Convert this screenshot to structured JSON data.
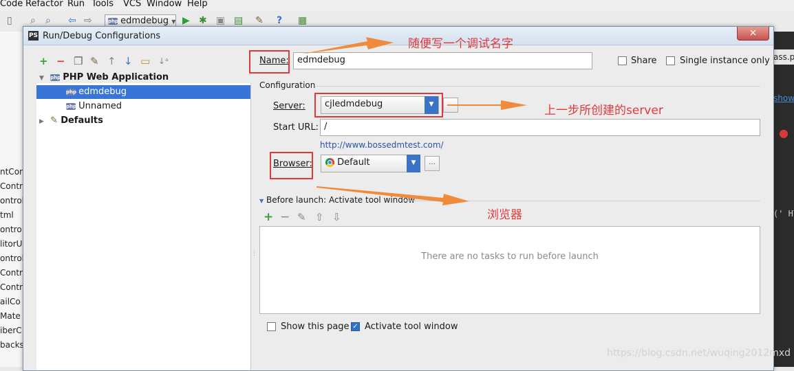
{
  "menubar": {
    "items": [
      "Code",
      "Refactor",
      "Run",
      "Tools",
      "VCS",
      "Window",
      "Help"
    ]
  },
  "toolbar": {
    "run_config_combo": "edmdebug",
    "icons": [
      "open-icon",
      "find-icon",
      "replace-icon",
      "back-icon",
      "forward-icon",
      "run-icon",
      "debug-icon",
      "coverage-icon",
      "vcs-icon",
      "settings-icon",
      "help-icon",
      "plugin-icon"
    ]
  },
  "background": {
    "left_lines": [
      "ntConf",
      "Contro",
      "ontrol",
      "tml",
      "ontro",
      "litorU",
      "ontrol",
      "Contro",
      "Contr",
      "ailCo",
      "Mate",
      "iberC",
      "backs"
    ],
    "right_lines": [
      "ass.ph",
      "show",
      "(' HT"
    ]
  },
  "dialog": {
    "title": "Run/Debug Configurations",
    "close_label": "×",
    "left_toolbar": [
      "add-icon",
      "remove-icon",
      "copy-icon",
      "edit-defaults-icon",
      "move-up-icon",
      "move-down-icon",
      "folder-icon",
      "sort-icon"
    ],
    "tree": {
      "group": "PHP Web Application",
      "items": [
        "edmdebug",
        "Unnamed"
      ],
      "selected": "edmdebug",
      "defaults": "Defaults"
    },
    "name_label": "Name:",
    "name_value": "edmdebug",
    "share_label": "Share",
    "single_instance_label": "Single instance only",
    "share_checked": false,
    "single_instance_checked": false,
    "configuration_label": "Configuration",
    "server_label": "Server:",
    "server_value": "cjledmdebug",
    "start_url_label": "Start URL:",
    "start_url_value": "/",
    "url_preview": "http://www.bossedmtest.com/",
    "browser_label": "Browser:",
    "browser_value": "Default",
    "dots_label": "...",
    "before_launch_label": "Before launch: Activate tool window",
    "before_launch_tools": [
      "add-task-icon",
      "remove-task-icon",
      "edit-task-icon",
      "task-up-icon",
      "task-down-icon"
    ],
    "no_tasks_text": "There are no tasks to run before launch",
    "show_page_label": "Show this page",
    "show_page_checked": false,
    "activate_label": "Activate tool window",
    "activate_checked": true
  },
  "annotations": {
    "name_note": "随便写一个调试名字",
    "server_note": "上一步所创建的server",
    "browser_note": "浏览器",
    "color": "#e2383b",
    "arrow_color": "#f08a3c"
  },
  "watermark": "https://blog.csdn.net/wuqing2012mxd"
}
